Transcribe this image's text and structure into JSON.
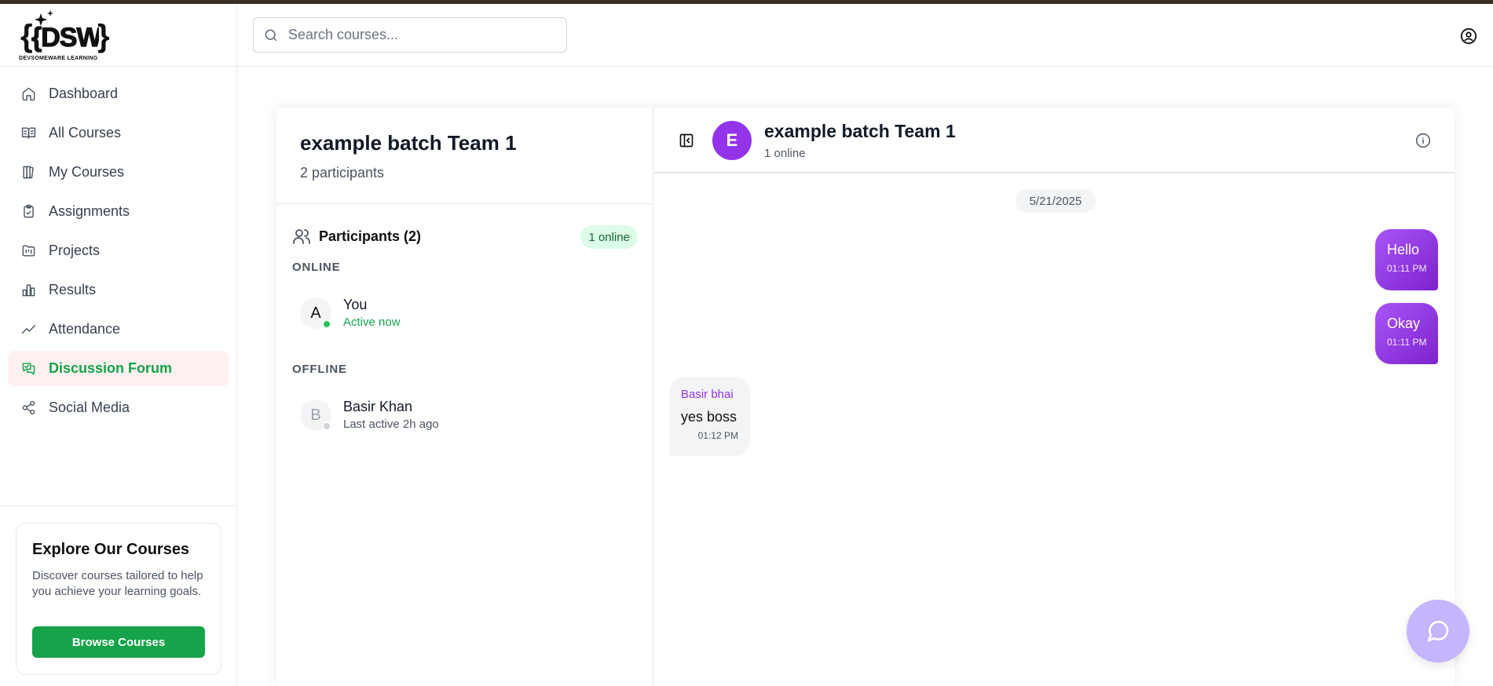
{
  "brand": {
    "logo_text": "{DSW}",
    "caption": "DEVSOMEWARE LEARNING"
  },
  "header": {
    "search_placeholder": "Search courses...",
    "user_icon": "user-circle-icon"
  },
  "sidebar": {
    "items": [
      {
        "label": "Dashboard",
        "icon": "home-icon",
        "active": false
      },
      {
        "label": "All Courses",
        "icon": "book-open-icon",
        "active": false
      },
      {
        "label": "My Courses",
        "icon": "library-icon",
        "active": false
      },
      {
        "label": "Assignments",
        "icon": "clipboard-check-icon",
        "active": false
      },
      {
        "label": "Projects",
        "icon": "folder-kanban-icon",
        "active": false
      },
      {
        "label": "Results",
        "icon": "bar-chart-icon",
        "active": false
      },
      {
        "label": "Attendance",
        "icon": "trending-up-icon",
        "active": false
      },
      {
        "label": "Discussion Forum",
        "icon": "messages-icon",
        "active": true
      },
      {
        "label": "Social Media",
        "icon": "share-icon",
        "active": false
      }
    ],
    "promo": {
      "title": "Explore Our Courses",
      "description": "Discover courses tailored to help you achieve your learning goals.",
      "button_label": "Browse Courses"
    }
  },
  "group": {
    "title": "example batch Team 1",
    "participants_count_text": "2 participants",
    "participants_label": "Participants (2)",
    "online_badge": "1 online",
    "online_section": "ONLINE",
    "offline_section": "OFFLINE",
    "online": [
      {
        "initial": "A",
        "name": "You",
        "status": "Active now",
        "status_color": "#16a34a"
      }
    ],
    "offline": [
      {
        "initial": "B",
        "name": "Basir Khan",
        "status": "Last active 2h ago",
        "status_color": "#4b5563"
      }
    ]
  },
  "chat": {
    "avatar_initial": "E",
    "title": "example batch Team 1",
    "subtitle": "1 online",
    "date": "5/21/2025",
    "outgoing": [
      {
        "text": "Hello",
        "time": "01:11 PM"
      },
      {
        "text": "Okay",
        "time": "01:11 PM"
      }
    ],
    "incoming": [
      {
        "sender": "Basir bhai",
        "text": "yes boss",
        "time": "01:12 PM"
      }
    ]
  },
  "colors": {
    "accent_green": "#16a34a",
    "accent_purple": "#9333ea",
    "active_nav_bg": "#fff0f0"
  }
}
